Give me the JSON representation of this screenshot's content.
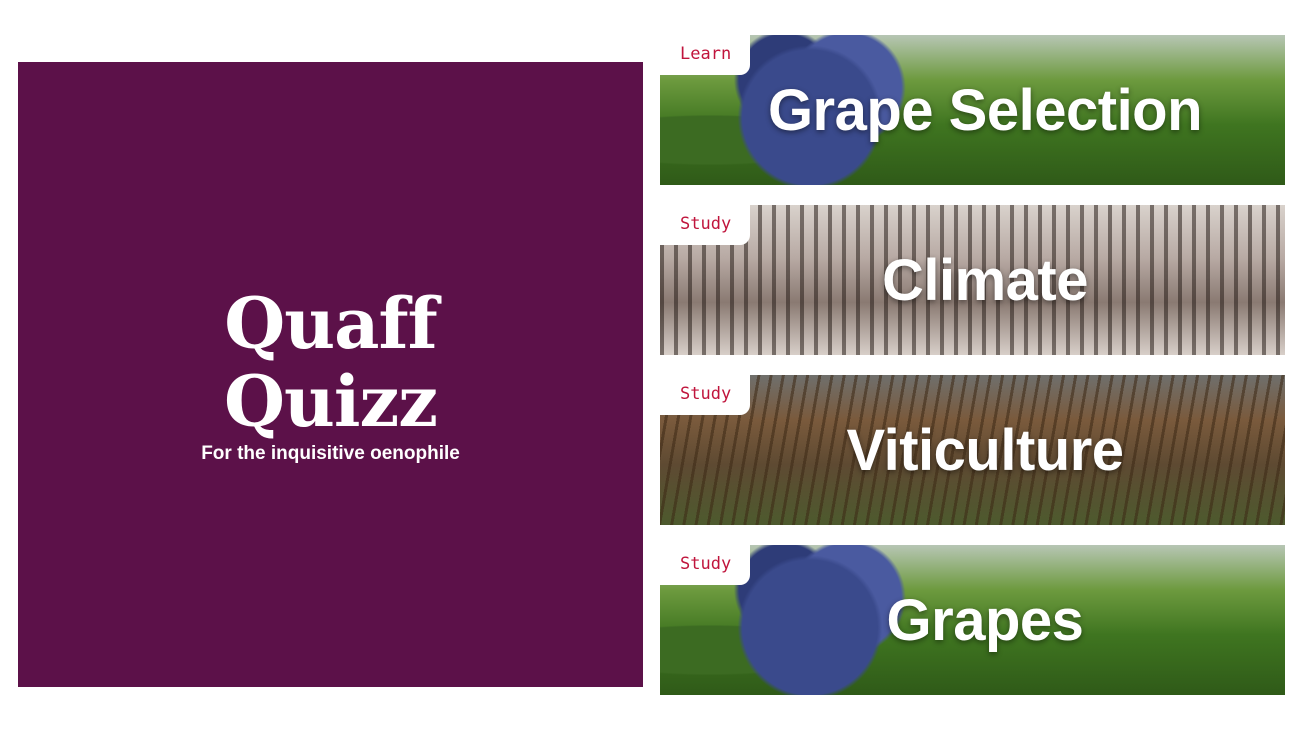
{
  "hero": {
    "title_line1": "Quaff",
    "title_line2": "Quizz",
    "subtitle": "For the inquisitive oenophile",
    "background_color": "#5c1149"
  },
  "cards": [
    {
      "tag": "Learn",
      "title": "Grape Selection",
      "image": "grapes-vineyard-photo"
    },
    {
      "tag": "Study",
      "title": "Climate",
      "image": "frosted-vineyard-photo"
    },
    {
      "tag": "Study",
      "title": "Viticulture",
      "image": "autumn-vineyard-photo"
    },
    {
      "tag": "Study",
      "title": "Grapes",
      "image": "grapes-vineyard-photo"
    }
  ],
  "tag_color": "#c0143c"
}
